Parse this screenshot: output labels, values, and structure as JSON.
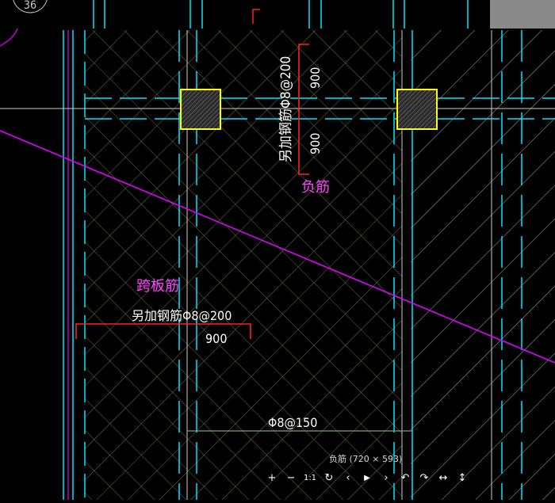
{
  "viewer": {
    "caption": "负筋 (720 × 593)",
    "toolbar": [
      {
        "name": "zoom-in-icon",
        "glyph": "+"
      },
      {
        "name": "zoom-out-icon",
        "glyph": "−"
      },
      {
        "name": "actual-size-icon",
        "glyph": "1:1"
      },
      {
        "name": "rotate-icon",
        "glyph": "↻"
      },
      {
        "name": "previous-icon",
        "glyph": "‹"
      },
      {
        "name": "play-icon",
        "glyph": "▶"
      },
      {
        "name": "next-icon",
        "glyph": "›"
      },
      {
        "name": "undo-icon",
        "glyph": "↶"
      },
      {
        "name": "redo-icon",
        "glyph": "↷"
      },
      {
        "name": "flip-horizontal-icon",
        "glyph": "↔"
      },
      {
        "name": "flip-vertical-icon",
        "glyph": "↕"
      }
    ]
  },
  "drawing": {
    "grid_bubble": "36",
    "negative_rebar_label": "负筋",
    "negative_rebar_note": "另加钢筋Φ8@200",
    "negative_rebar_dim_top": "900",
    "negative_rebar_dim_bottom": "900",
    "span_rebar_label": "跨板筋",
    "span_rebar_note": "另加钢筋Φ8@200",
    "span_rebar_dim": "900",
    "slab_rebar_note": "Φ8@150",
    "colors": {
      "axis": "#00e5ff",
      "rebar": "#ff2020",
      "column": "#ffff00",
      "label": "#ff44ff",
      "cut_line": "#e000ff",
      "hatch": "#9b9b5a"
    }
  }
}
